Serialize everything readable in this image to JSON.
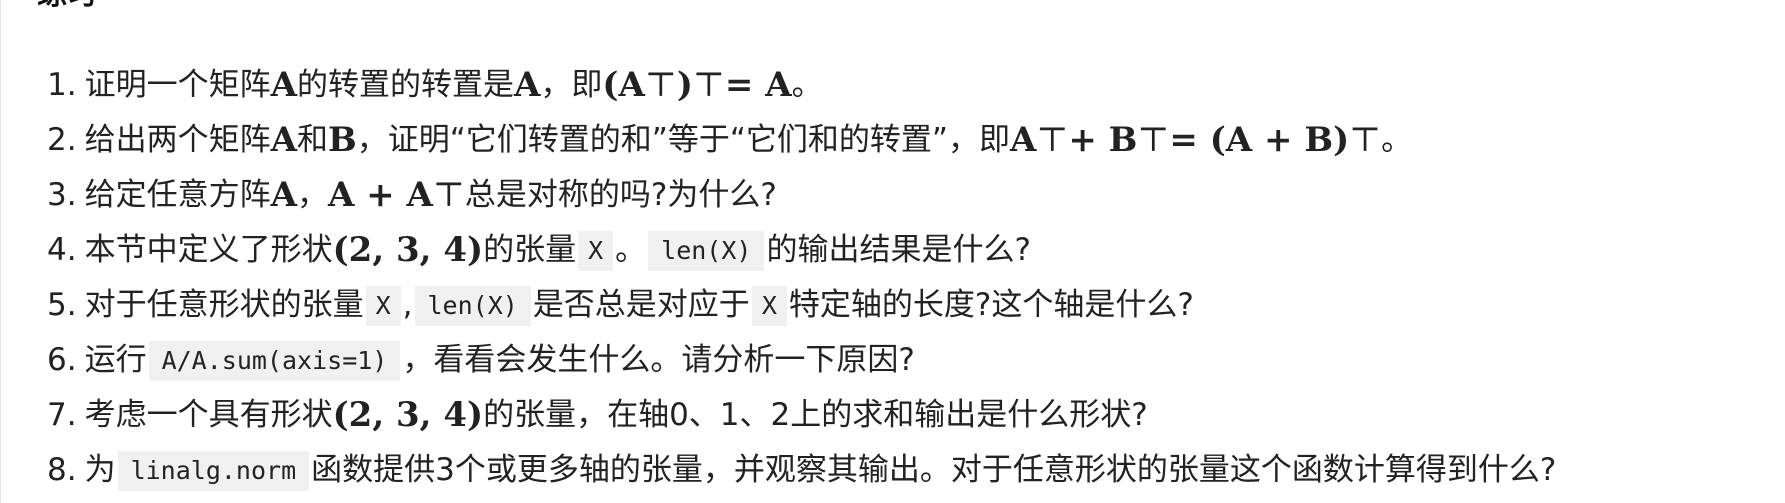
{
  "heading_fragment": "练习",
  "exercises": [
    {
      "number": "1.",
      "segments": [
        {
          "text": "证明一个矩阵"
        },
        {
          "math": "A"
        },
        {
          "text": "的转置的转置是"
        },
        {
          "math": "A"
        },
        {
          "text": "，即"
        },
        {
          "math": "(A"
        },
        {
          "sup": "⊤"
        },
        {
          "math": ")"
        },
        {
          "sup": "⊤"
        },
        {
          "math": " = A"
        },
        {
          "text": "。"
        }
      ]
    },
    {
      "number": "2.",
      "segments": [
        {
          "text": "给出两个矩阵"
        },
        {
          "math": "A"
        },
        {
          "text": "和"
        },
        {
          "math": "B"
        },
        {
          "text": "，证明“它们转置的和”等于“它们和的转置”，即"
        },
        {
          "math": "A"
        },
        {
          "sup": "⊤"
        },
        {
          "math": " + B"
        },
        {
          "sup": "⊤"
        },
        {
          "math": " = (A + B)"
        },
        {
          "sup": "⊤"
        },
        {
          "text": "。"
        }
      ]
    },
    {
      "number": "3.",
      "segments": [
        {
          "text": "给定任意方阵"
        },
        {
          "math": "A"
        },
        {
          "text": "，"
        },
        {
          "math": "A + A"
        },
        {
          "sup": "⊤"
        },
        {
          "text": "总是对称的吗?为什么?"
        }
      ]
    },
    {
      "number": "4.",
      "segments": [
        {
          "text": "本节中定义了形状"
        },
        {
          "math": "(2, 3, 4)"
        },
        {
          "text": "的张量"
        },
        {
          "code": "X"
        },
        {
          "text": "。"
        },
        {
          "code": "len(X)"
        },
        {
          "text": "的输出结果是什么?"
        }
      ]
    },
    {
      "number": "5.",
      "segments": [
        {
          "text": "对于任意形状的张量"
        },
        {
          "code": "X"
        },
        {
          "text": ","
        },
        {
          "code": "len(X)"
        },
        {
          "text": "是否总是对应于"
        },
        {
          "code": "X"
        },
        {
          "text": "特定轴的长度?这个轴是什么?"
        }
      ]
    },
    {
      "number": "6.",
      "segments": [
        {
          "text": "运行"
        },
        {
          "code": "A/A.sum(axis=1)"
        },
        {
          "text": "，看看会发生什么。请分析一下原因?"
        }
      ]
    },
    {
      "number": "7.",
      "segments": [
        {
          "text": "考虑一个具有形状"
        },
        {
          "math": "(2, 3, 4)"
        },
        {
          "text": "的张量，在轴0、1、2上的求和输出是什么形状?"
        }
      ]
    },
    {
      "number": "8.",
      "segments": [
        {
          "text": "为"
        },
        {
          "code": "linalg.norm"
        },
        {
          "text": "函数提供3个或更多轴的张量，并观察其输出。对于任意形状的张量这个函数计算得到什么?"
        }
      ]
    }
  ]
}
